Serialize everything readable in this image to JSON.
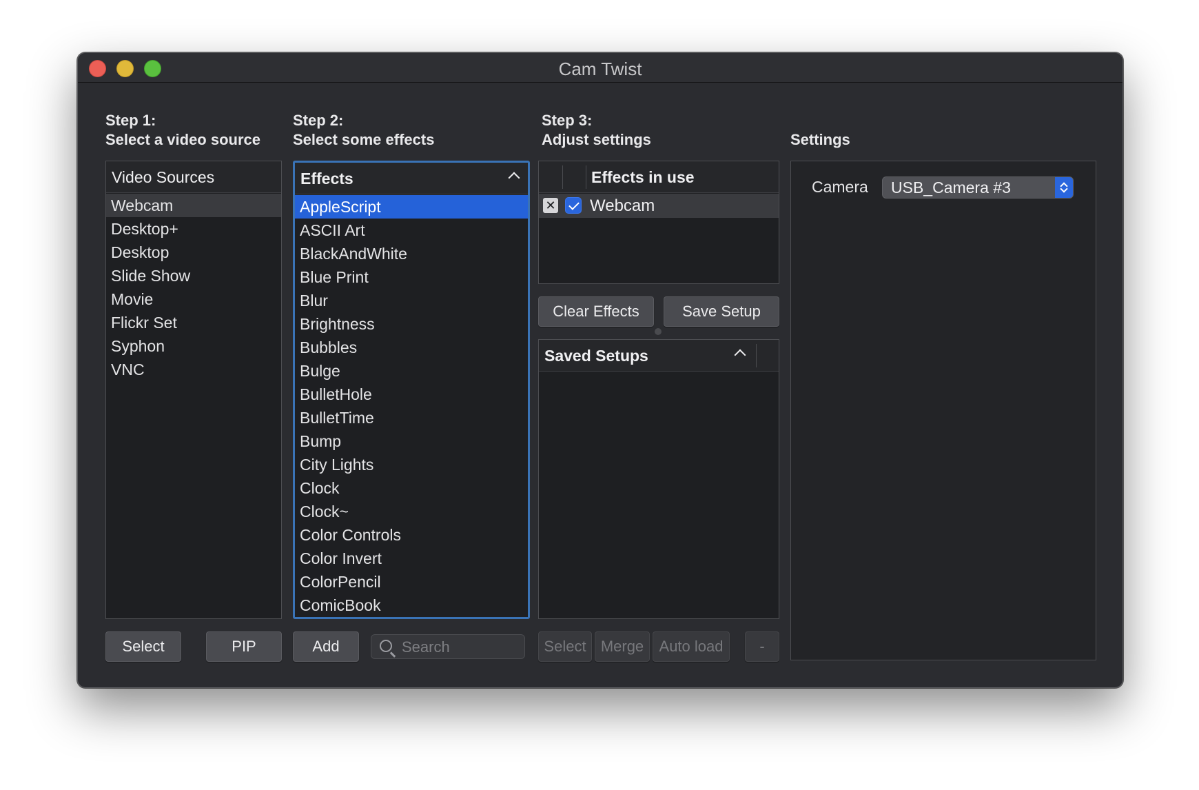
{
  "window": {
    "title": "Cam Twist"
  },
  "steps": {
    "step1": {
      "line1": "Step 1:",
      "line2": "Select a video source"
    },
    "step2": {
      "line1": "Step 2:",
      "line2": "Select some effects"
    },
    "step3": {
      "line1": "Step 3:",
      "line2": "Adjust settings"
    },
    "settings": {
      "line1": "Settings"
    }
  },
  "video_sources": {
    "header": "Video Sources",
    "items": [
      "Webcam",
      "Desktop+",
      "Desktop",
      "Slide Show",
      "Movie",
      "Flickr Set",
      "Syphon",
      "VNC"
    ],
    "selected": "Webcam"
  },
  "effects": {
    "header": "Effects",
    "items": [
      "AppleScript",
      "ASCII Art",
      "BlackAndWhite",
      "Blue Print",
      "Blur",
      "Brightness",
      "Bubbles",
      "Bulge",
      "BulletHole",
      "BulletTime",
      "Bump",
      "City Lights",
      "Clock",
      "Clock~",
      "Color Controls",
      "Color Invert",
      "ColorPencil",
      "ComicBook"
    ],
    "selected": "AppleScript"
  },
  "effects_in_use": {
    "header": "Effects in use",
    "items": [
      {
        "remove": "✕",
        "checked": true,
        "name": "Webcam"
      }
    ]
  },
  "saved_setups": {
    "header": "Saved Setups"
  },
  "buttons": {
    "select": "Select",
    "pip": "PIP",
    "add": "Add",
    "clear_effects": "Clear Effects",
    "save_setup": "Save Setup",
    "setup_select": "Select",
    "merge": "Merge",
    "auto_load": "Auto load",
    "remove_setup": "-"
  },
  "search": {
    "placeholder": "Search",
    "value": ""
  },
  "settings_panel": {
    "camera_label": "Camera",
    "camera_value": "USB_Camera #3"
  },
  "colors": {
    "selection_blue": "#2562d9",
    "window_bg": "#2b2c30",
    "panel_bg": "#1e1f22"
  }
}
